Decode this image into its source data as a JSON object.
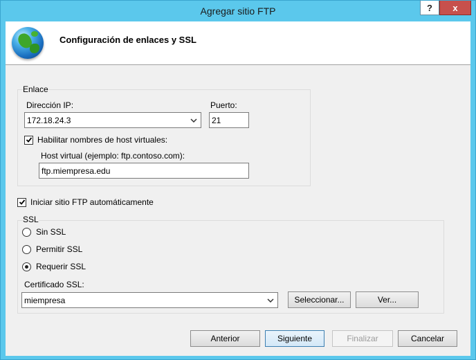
{
  "window": {
    "title": "Agregar sitio FTP",
    "help_glyph": "?",
    "close_glyph": "x"
  },
  "header": {
    "title": "Configuración de enlaces y SSL",
    "icon": "globe-icon"
  },
  "binding": {
    "group_label": "Enlace",
    "ip_label": "Dirección IP:",
    "ip_value": "172.18.24.3",
    "port_label": "Puerto:",
    "port_value": "21",
    "virtual_host_check_label": "Habilitar nombres de host virtuales:",
    "virtual_host_checked": true,
    "virtual_host_label": "Host virtual (ejemplo: ftp.contoso.com):",
    "virtual_host_value": "ftp.miempresa.edu"
  },
  "autostart": {
    "label": "Iniciar sitio FTP automáticamente",
    "checked": true
  },
  "ssl": {
    "group_label": "SSL",
    "options": [
      "Sin SSL",
      "Permitir SSL",
      "Requerir SSL"
    ],
    "selected": "Requerir SSL",
    "cert_label": "Certificado SSL:",
    "cert_value": "miempresa",
    "select_button": "Seleccionar...",
    "view_button": "Ver..."
  },
  "footer": {
    "back": "Anterior",
    "next": "Siguiente",
    "finish": "Finalizar",
    "cancel": "Cancelar"
  }
}
